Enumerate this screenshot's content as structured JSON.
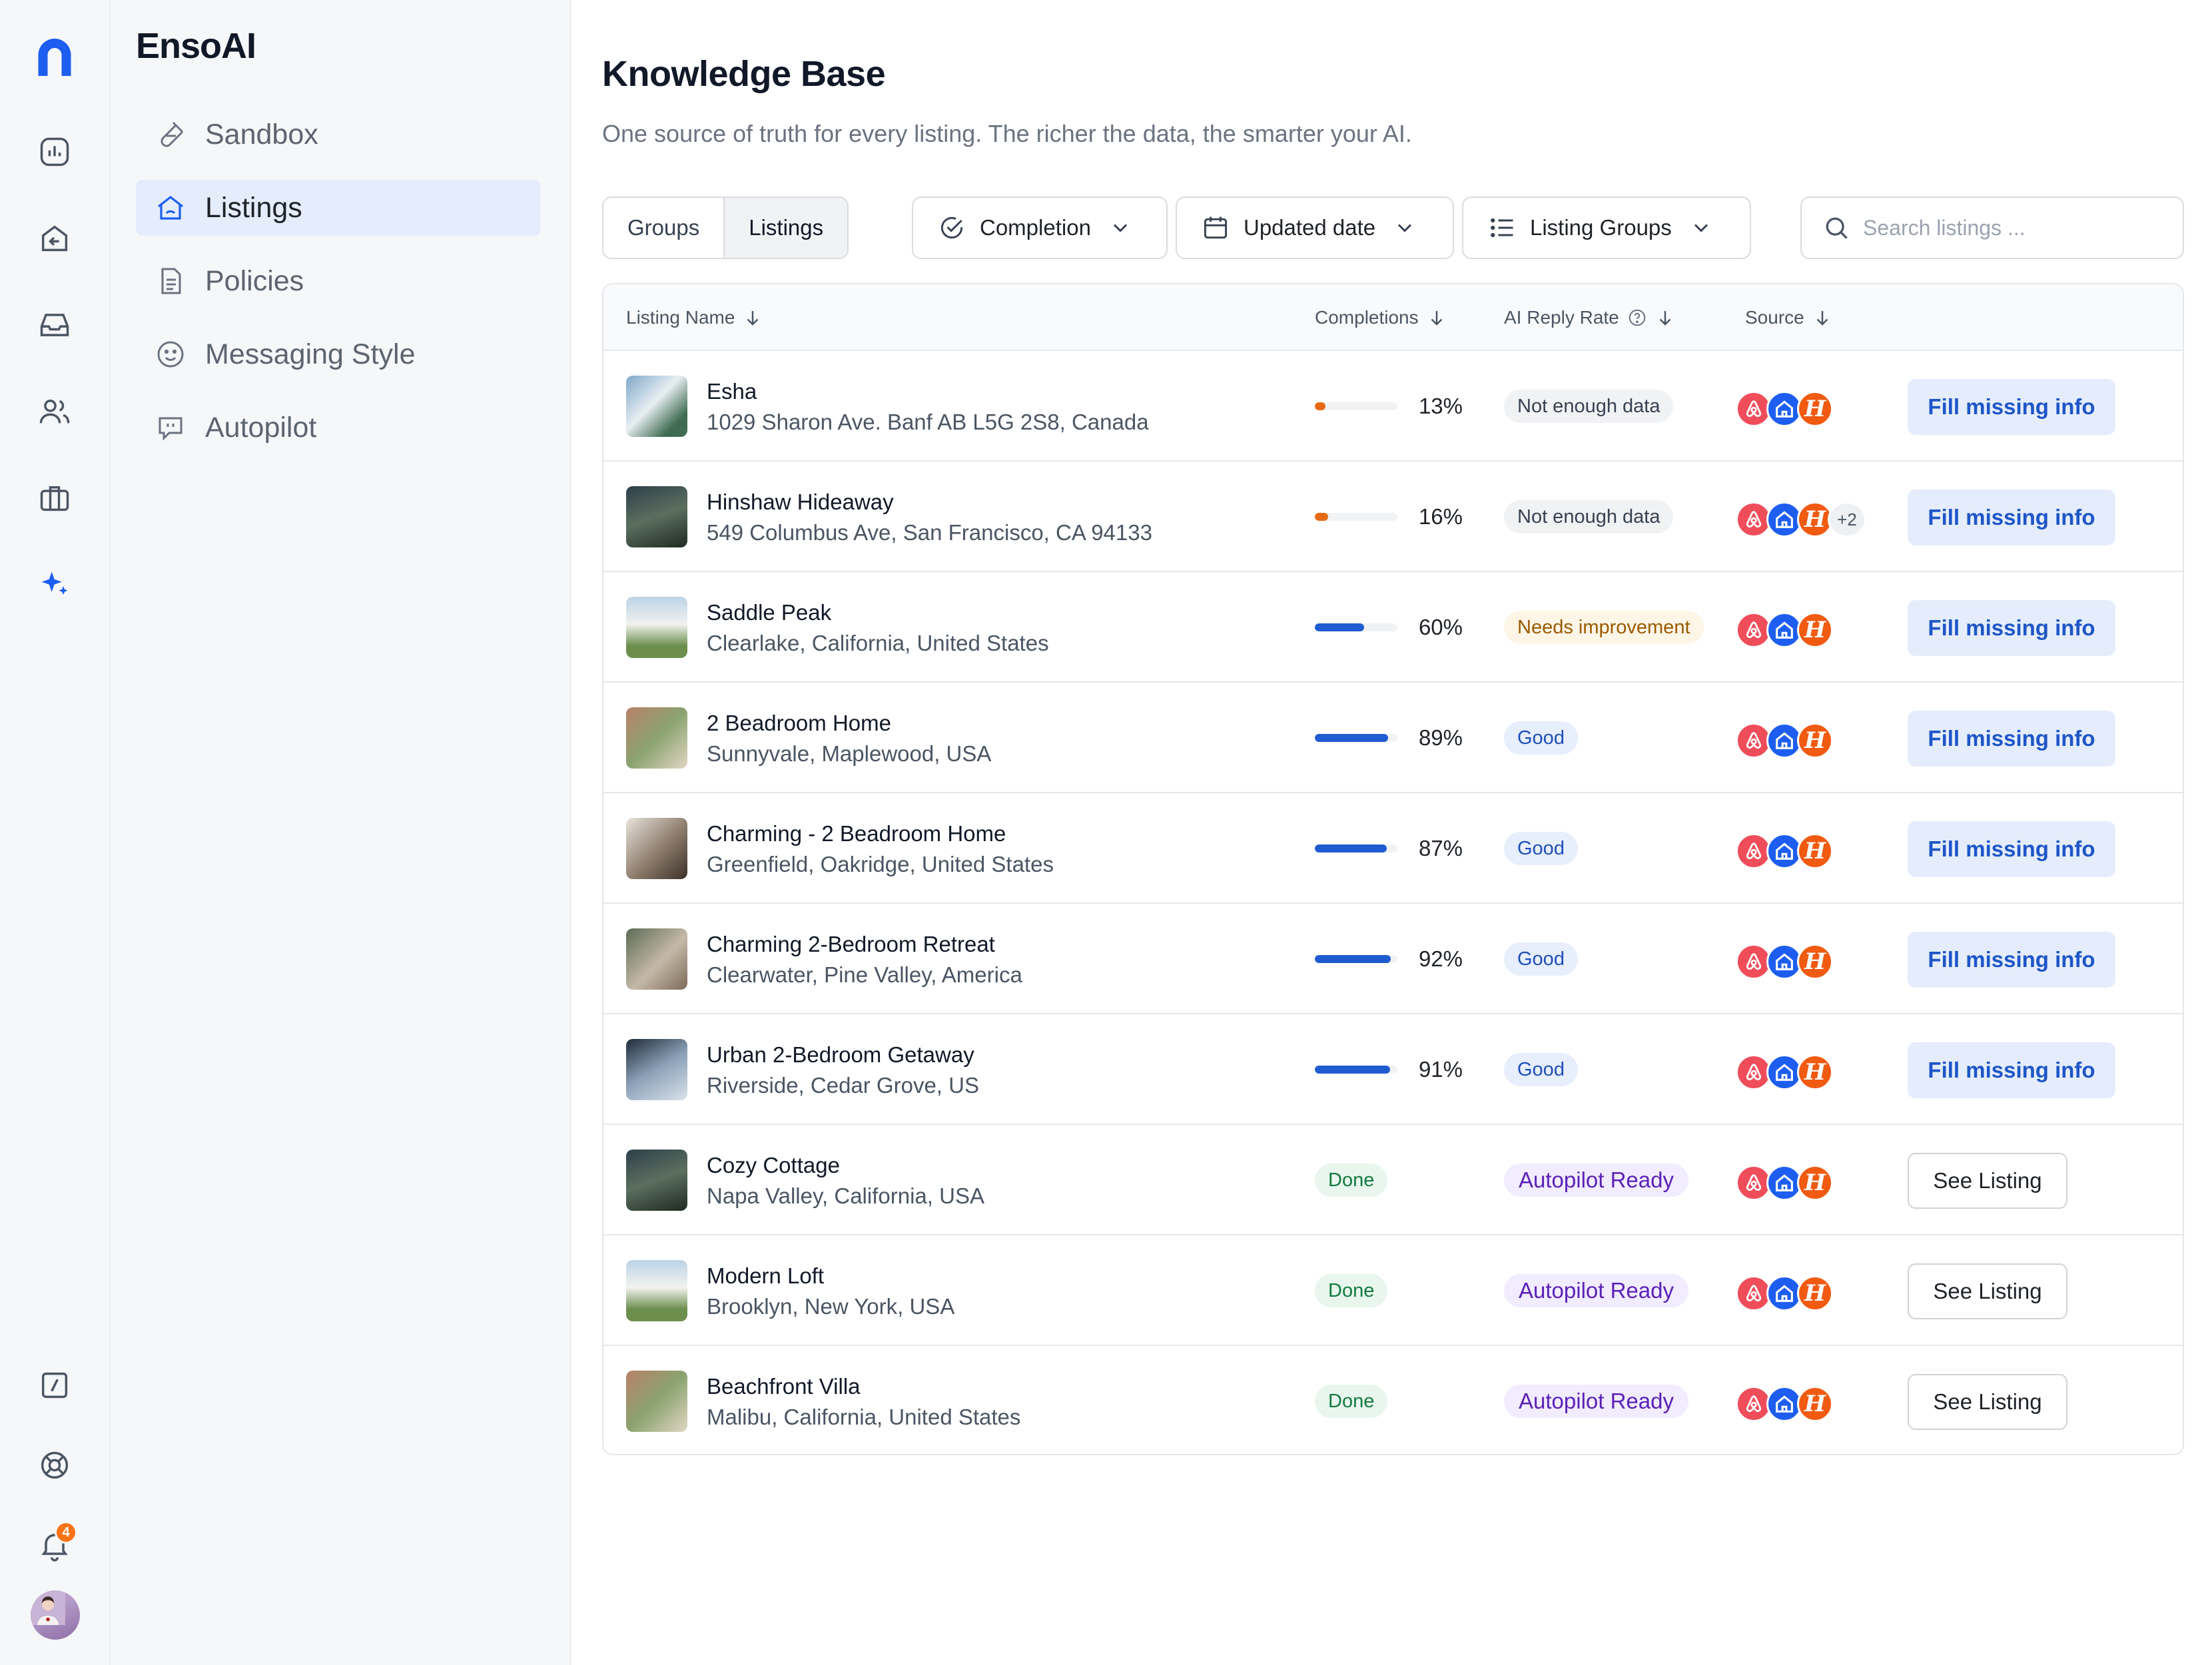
{
  "brand": "EnsoAI",
  "rail": {
    "notifications_count": "4"
  },
  "nav": {
    "items": [
      {
        "label": "Sandbox",
        "icon": "flask-icon"
      },
      {
        "label": "Listings",
        "icon": "home-icon",
        "active": true
      },
      {
        "label": "Policies",
        "icon": "document-icon"
      },
      {
        "label": "Messaging Style",
        "icon": "smiley-icon"
      },
      {
        "label": "Autopilot",
        "icon": "chat-bubble-icon"
      }
    ]
  },
  "page": {
    "title": "Knowledge Base",
    "subtitle": "One source of truth for every listing. The richer the data, the smarter your AI."
  },
  "toolbar": {
    "view_toggle": [
      "Groups",
      "Listings"
    ],
    "view_selected": "Listings",
    "filters": [
      "Completion",
      "Updated date",
      "Listing Groups"
    ],
    "search_placeholder": "Search listings ..."
  },
  "table": {
    "columns": [
      "Listing Name",
      "Completions",
      "AI Reply Rate",
      "Source"
    ],
    "rows": [
      {
        "name": "Esha",
        "address": "1029 Sharon Ave. Banf AB L5G 2S8, Canada",
        "completion": 0.13,
        "completion_label": "13%",
        "reply_rate": "Not enough data",
        "status": "gray",
        "extra_sources": "",
        "action": "Fill missing info"
      },
      {
        "name": "Hinshaw Hideaway",
        "address": "549 Columbus Ave, San Francisco, CA 94133",
        "completion": 0.16,
        "completion_label": "16%",
        "reply_rate": "Not enough data",
        "status": "gray",
        "extra_sources": "+2",
        "action": "Fill missing info"
      },
      {
        "name": "Saddle Peak",
        "address": "Clearlake, California, United States",
        "completion": 0.6,
        "completion_label": "60%",
        "reply_rate": "Needs improvement",
        "status": "amber",
        "extra_sources": "",
        "action": "Fill missing info"
      },
      {
        "name": "2 Beadroom Home",
        "address": "Sunnyvale, Maplewood, USA",
        "completion": 0.89,
        "completion_label": "89%",
        "reply_rate": "Good",
        "status": "blue",
        "extra_sources": "",
        "action": "Fill missing info"
      },
      {
        "name": "Charming - 2 Beadroom Home",
        "address": "Greenfield, Oakridge, United States",
        "completion": 0.87,
        "completion_label": "87%",
        "reply_rate": "Good",
        "status": "blue",
        "extra_sources": "",
        "action": "Fill missing info"
      },
      {
        "name": "Charming 2-Bedroom Retreat",
        "address": "Clearwater, Pine Valley, America",
        "completion": 0.92,
        "completion_label": "92%",
        "reply_rate": "Good",
        "status": "blue",
        "extra_sources": "",
        "action": "Fill missing info"
      },
      {
        "name": "Urban 2-Bedroom Getaway",
        "address": "Riverside, Cedar Grove, US",
        "completion": 0.91,
        "completion_label": "91%",
        "reply_rate": "Good",
        "status": "blue",
        "extra_sources": "",
        "action": "Fill missing info"
      },
      {
        "name": "Cozy Cottage",
        "address": "Napa Valley, California, USA",
        "completion_label": "Done",
        "reply_rate": "Autopilot Ready",
        "status": "auto",
        "extra_sources": "",
        "action": "See Listing"
      },
      {
        "name": "Modern Loft",
        "address": "Brooklyn, New York, USA",
        "completion_label": "Done",
        "reply_rate": "Autopilot Ready",
        "status": "auto",
        "extra_sources": "",
        "action": "See Listing"
      },
      {
        "name": "Beachfront Villa",
        "address": "Malibu, California, United States",
        "completion_label": "Done",
        "reply_rate": "Autopilot Ready",
        "status": "auto",
        "extra_sources": "",
        "action": "See Listing"
      }
    ]
  },
  "colors": {
    "accent": "#1f5bd1",
    "airbnb": "#ef4d5a",
    "vrbo": "#1d5ef0",
    "hostaway": "#f15a11",
    "low_progress": "#e66a12"
  }
}
